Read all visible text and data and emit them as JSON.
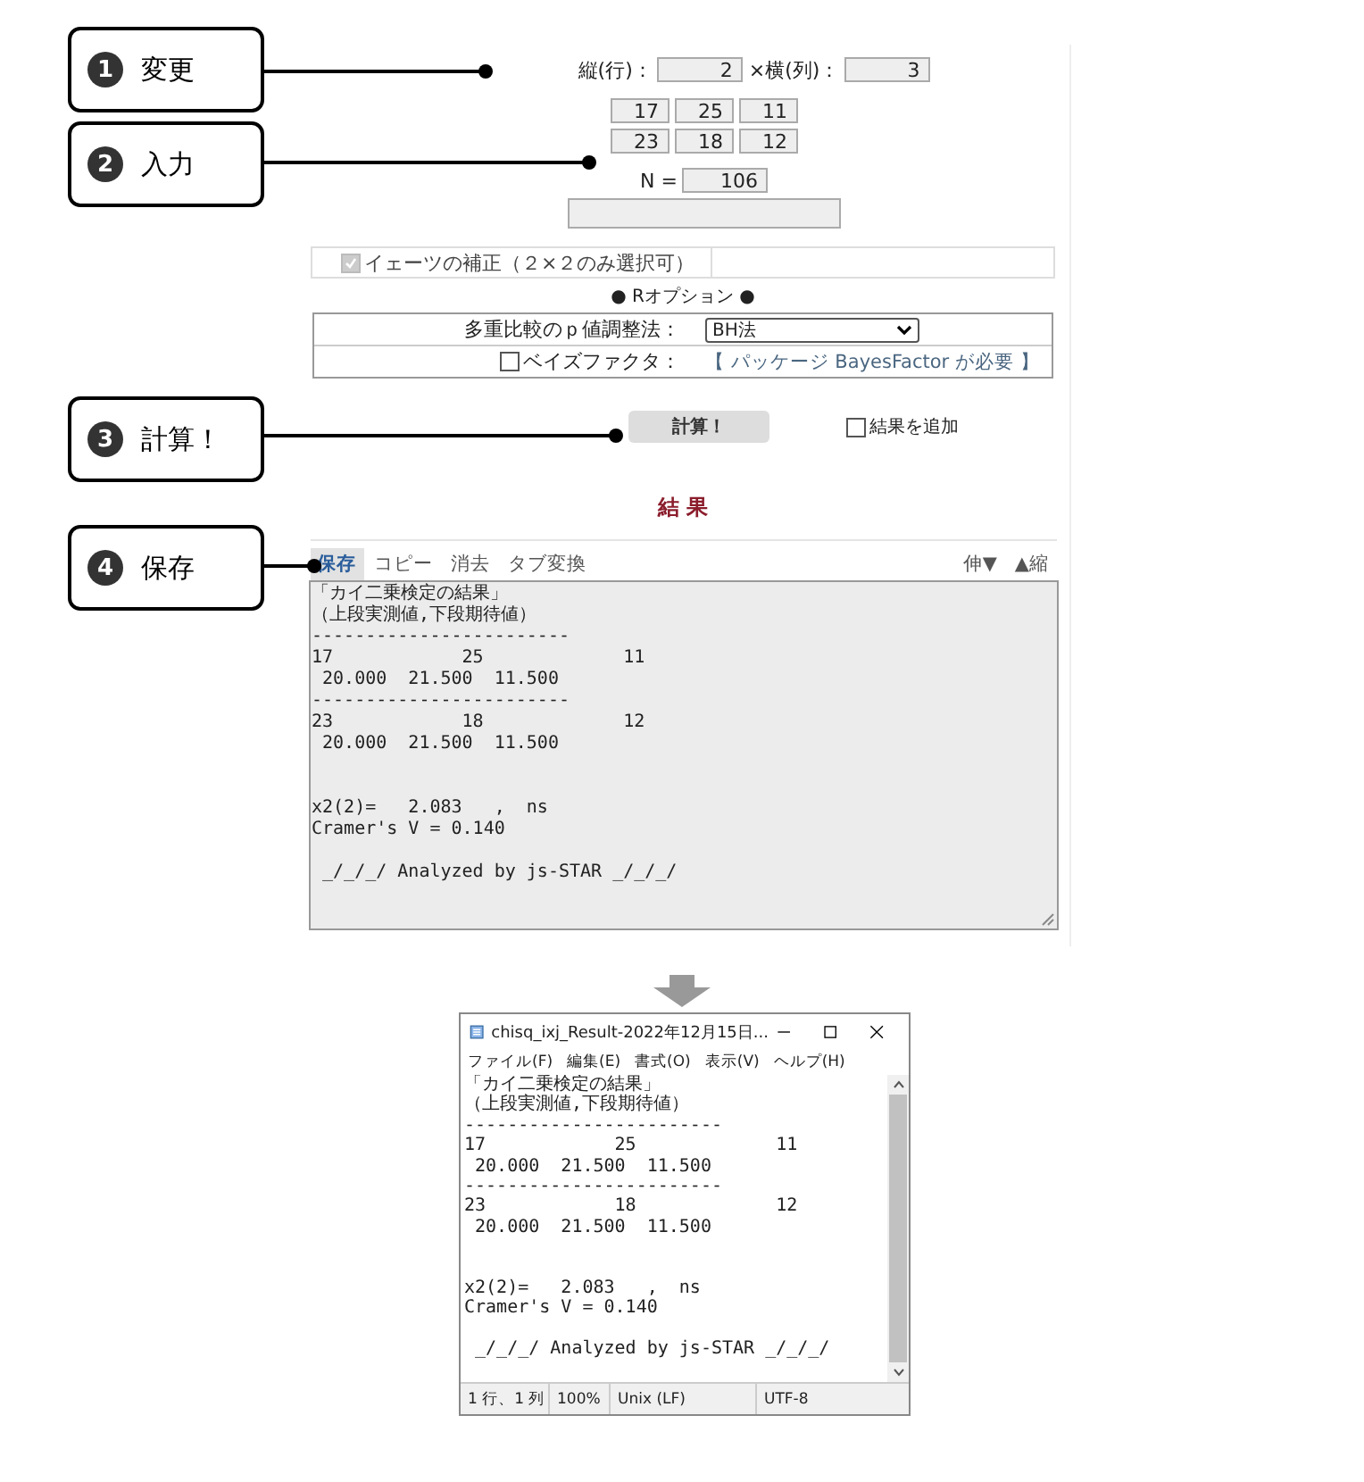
{
  "callouts": [
    {
      "number": "1",
      "label": "変更"
    },
    {
      "number": "2",
      "label": "入力"
    },
    {
      "number": "3",
      "label": "計算！"
    },
    {
      "number": "4",
      "label": "保存"
    }
  ],
  "dimensions": {
    "rows_label": "縦(行)：",
    "rows": "2",
    "cols_label": "×横(列)：",
    "cols": "3"
  },
  "cells": [
    [
      "17",
      "25",
      "11"
    ],
    [
      "23",
      "18",
      "12"
    ]
  ],
  "n_label": "N =",
  "n": "106",
  "yates": {
    "label": "イェーツの補正（２×２のみ選択可）",
    "checked": true,
    "disabled": true
  },
  "r_options_title": "● Rオプション ●",
  "p_adjust": {
    "label": "多重比較のｐ値調整法：",
    "value": "BH法"
  },
  "bayes": {
    "label": "ベイズファクタ：",
    "checked": false,
    "note": "【 パッケージ BayesFactor が必要 】"
  },
  "calc_button": "計算！",
  "append_result": {
    "label": "結果を追加",
    "checked": false
  },
  "result_title": "結 果",
  "toolbar": {
    "tabs": [
      {
        "label": "保存",
        "selected": true
      },
      {
        "label": "コピー",
        "selected": false
      },
      {
        "label": "消去",
        "selected": false
      },
      {
        "label": "タブ変換",
        "selected": false
      }
    ],
    "right": [
      "伸▼",
      "▲縮"
    ]
  },
  "result_blocks": [
    [
      "「カイ二乗検定の結果」",
      "（上段実測値,下段期待値）",
      "------------------------",
      "17            25             11",
      " 20.000  21.500  11.500",
      "------------------------",
      "23            18             12",
      " 20.000  21.500  11.500"
    ],
    [
      "x2(2)=   2.083   ,  ns",
      "Cramer's V = 0.140"
    ],
    [
      " _/_/_/ Analyzed by js-STAR _/_/_/"
    ]
  ],
  "notepad": {
    "title": "chisq_ixj_Result-2022年12月15日...",
    "menu": [
      "ファイル(F)",
      "編集(E)",
      "書式(O)",
      "表示(V)",
      "ヘルプ(H)"
    ],
    "blocks": [
      [
        "「カイ二乗検定の結果」",
        "（上段実測値,下段期待値）",
        "------------------------",
        "17            25             11",
        " 20.000  21.500  11.500",
        "------------------------",
        "23            18             12",
        " 20.000  21.500  11.500"
      ],
      [
        "x2(2)=   2.083   ,  ns",
        "Cramer's V = 0.140"
      ],
      [
        " _/_/_/ Analyzed by js-STAR _/_/_/"
      ]
    ],
    "status": [
      "1 行、1 列",
      "100%",
      "Unix (LF)",
      "UTF-8"
    ]
  }
}
